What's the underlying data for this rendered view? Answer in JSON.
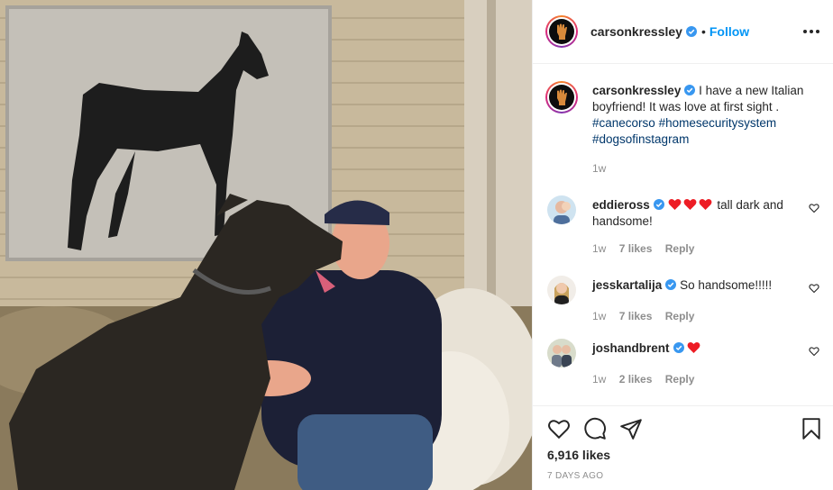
{
  "post": {
    "author": "carsonkressley",
    "follow_label": "Follow",
    "separator": "•",
    "caption": {
      "username": "carsonkressley",
      "text": "I have a new Italian boyfriend! It was love at first sight .",
      "hashtags": [
        "#canecorso",
        "#homesecuritysystem",
        "#dogsofinstagram"
      ],
      "time": "1w"
    },
    "comments": [
      {
        "username": "eddieross",
        "hearts": 3,
        "text": "tall dark and handsome!",
        "time": "1w",
        "likes": "7 likes",
        "reply": "Reply"
      },
      {
        "username": "jesskartalija",
        "hearts": 0,
        "text": "So handsome!!!!!",
        "time": "1w",
        "likes": "7 likes",
        "reply": "Reply"
      },
      {
        "username": "joshandbrent",
        "hearts": 1,
        "text": "",
        "time": "1w",
        "likes": "2 likes",
        "reply": "Reply"
      }
    ],
    "likes_count": "6,916 likes",
    "posted": "7 DAYS AGO"
  },
  "colors": {
    "accent": "#0095f6",
    "hashtag": "#00376b",
    "muted": "#8e8e8e",
    "heart_red": "#ed1c24",
    "text": "#262626"
  },
  "icons": {
    "more": "more-options-icon",
    "verified": "verified-badge-icon",
    "like": "heart-icon",
    "comment": "comment-icon",
    "share": "paper-plane-icon",
    "save": "bookmark-icon"
  }
}
